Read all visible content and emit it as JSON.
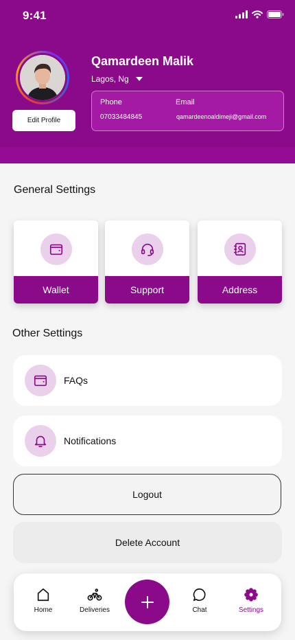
{
  "status_bar": {
    "time": "9:41"
  },
  "profile": {
    "name": "Qamardeen Malik",
    "location": "Lagos, Ng",
    "edit_label": "Edit Profile",
    "phone_label": "Phone",
    "phone": "07033484845",
    "email_label": "Email",
    "email": "qamardeenoaldimeji@gmail.com"
  },
  "general_settings": {
    "title": "General Settings",
    "cards": [
      {
        "label": "Wallet",
        "icon": "wallet-icon"
      },
      {
        "label": "Support",
        "icon": "headset-icon"
      },
      {
        "label": "Address",
        "icon": "contact-book-icon"
      }
    ]
  },
  "other_settings": {
    "title": "Other Settings",
    "items": [
      {
        "label": "FAQs",
        "icon": "wallet-icon"
      },
      {
        "label": "Notifications",
        "icon": "bell-icon"
      }
    ]
  },
  "actions": {
    "logout": "Logout",
    "delete_account": "Delete Account"
  },
  "bottom_nav": {
    "items": [
      {
        "label": "Home",
        "icon": "home-icon"
      },
      {
        "label": "Deliveries",
        "icon": "bicycle-icon"
      },
      {
        "label": "Chat",
        "icon": "chat-icon"
      },
      {
        "label": "Settings",
        "icon": "gear-icon",
        "active": true
      }
    ],
    "fab_icon": "plus-icon"
  },
  "colors": {
    "primary": "#8a0a8a",
    "icon_bg": "#ebd0eb",
    "background": "#f5f5f5"
  }
}
